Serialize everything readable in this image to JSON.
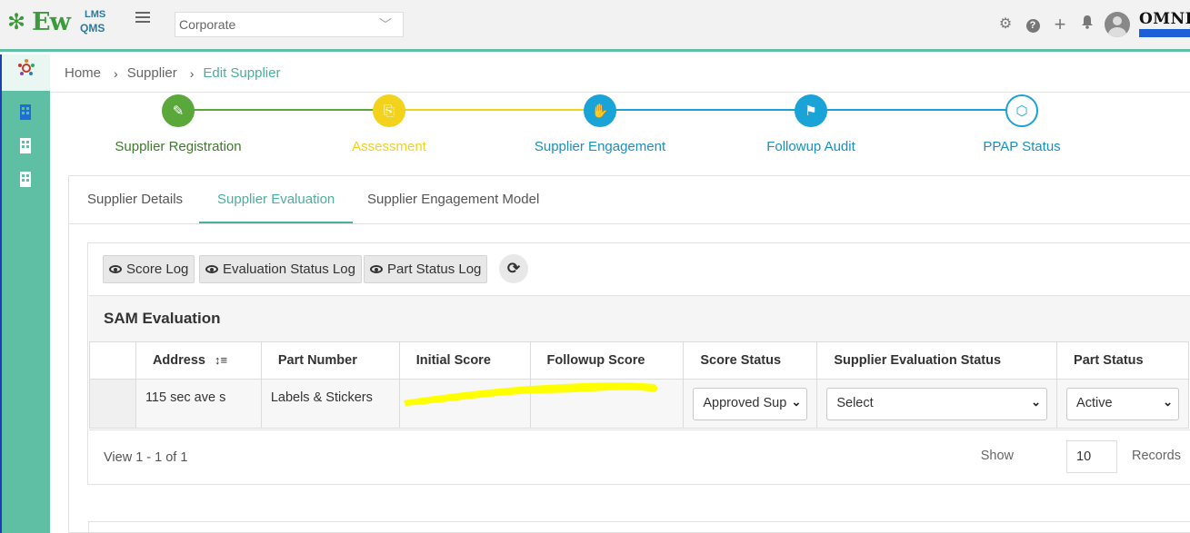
{
  "header": {
    "logo": {
      "main": "Ew",
      "top": "LMS",
      "bottom": "QMS"
    },
    "org_select": "Corporate",
    "brand": "OMNI",
    "icons": [
      "gear-icon",
      "help-icon",
      "plus-icon",
      "bell-icon",
      "avatar"
    ]
  },
  "breadcrumb": {
    "items": [
      "Home",
      "Supplier",
      "Edit Supplier"
    ]
  },
  "stepper": {
    "steps": [
      {
        "label": "Supplier Registration",
        "color": "#5aa83a"
      },
      {
        "label": "Assessment",
        "color": "#f2d21b"
      },
      {
        "label": "Supplier Engagement",
        "color": "#1aa3d6"
      },
      {
        "label": "Followup Audit",
        "color": "#1aa3d6"
      },
      {
        "label": "PPAP Status",
        "color": "#1aa3d6"
      }
    ]
  },
  "tabs": [
    "Supplier Details",
    "Supplier Evaluation",
    "Supplier Engagement Model"
  ],
  "toolbar": {
    "score_log": "Score Log",
    "evaluation_status_log": "Evaluation Status Log",
    "part_status_log": "Part Status Log"
  },
  "section_title": "SAM Evaluation",
  "table": {
    "columns": [
      "Address",
      "Part Number",
      "Initial Score",
      "Followup Score",
      "Score Status",
      "Supplier Evaluation Status",
      "Part Status"
    ],
    "rows": [
      {
        "address": "115 sec ave s",
        "part_number": "Labels & Stickers",
        "initial_score": "",
        "followup_score": "",
        "score_status": "Approved Sup",
        "supplier_evaluation_status": "Select",
        "part_status": "Active"
      }
    ]
  },
  "pager": {
    "view_text": "View 1 - 1 of 1",
    "show_label": "Show",
    "page_size": "10",
    "records_label": "Records"
  },
  "colors": {
    "accent": "#5fbfa5",
    "active_tab": "#4aaea0",
    "highlight": "#ffff00"
  }
}
